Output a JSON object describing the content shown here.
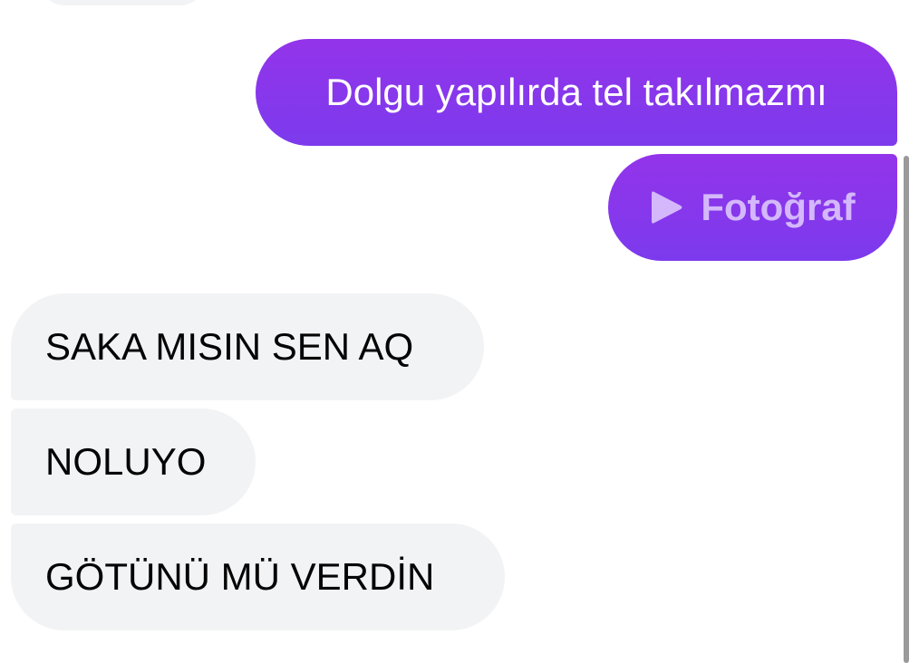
{
  "messages": [
    {
      "direction": "outgoing",
      "type": "text",
      "text": "Dolgu yapılırda tel takılmazmı"
    },
    {
      "direction": "outgoing",
      "type": "media",
      "icon": "play-icon",
      "text": "Fotoğraf"
    },
    {
      "direction": "incoming",
      "type": "text",
      "text": "SAKA MISIN SEN AQ"
    },
    {
      "direction": "incoming",
      "type": "text",
      "text": "NOLUYO"
    },
    {
      "direction": "incoming",
      "type": "text",
      "text": "GÖTÜNÜ MÜ VERDİN"
    }
  ],
  "colors": {
    "outgoing_bubble": "#8b3cf0",
    "incoming_bubble": "#f2f3f5",
    "media_label": "#d4b8fb",
    "scrollbar": "#9a9a9a"
  }
}
